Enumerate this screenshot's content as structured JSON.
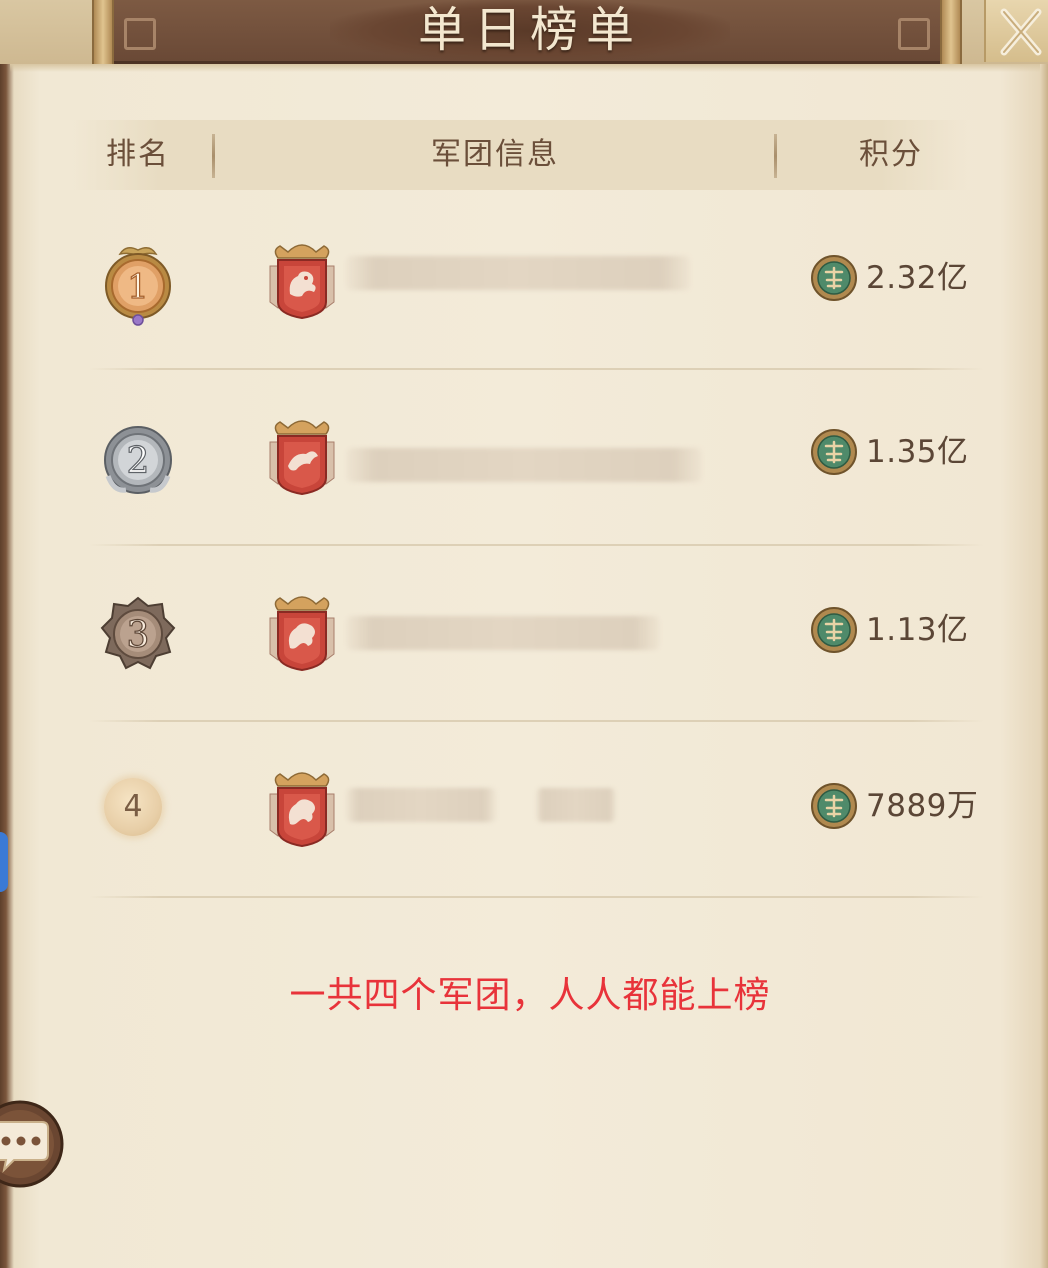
{
  "title": "单日榜单",
  "header": {
    "rank": "排名",
    "legion_info": "军团信息",
    "score": "积分"
  },
  "rows": [
    {
      "rank": "1",
      "score": "2.32亿"
    },
    {
      "rank": "2",
      "score": "1.35亿"
    },
    {
      "rank": "3",
      "score": "1.13亿"
    },
    {
      "rank": "4",
      "score": "7889万"
    }
  ],
  "note": "一共四个军团，人人都能上榜",
  "colors": {
    "parchment": "#f3ebd9",
    "title_plate": "#6a4936",
    "note_red": "#e8333a",
    "text_brown": "#5b4636"
  },
  "icons": [
    "close-icon",
    "rank-medal-gold-icon",
    "rank-medal-silver-icon",
    "rank-medal-bronze-icon",
    "legion-emblem-icon",
    "score-coin-icon",
    "chat-bubble-icon"
  ]
}
